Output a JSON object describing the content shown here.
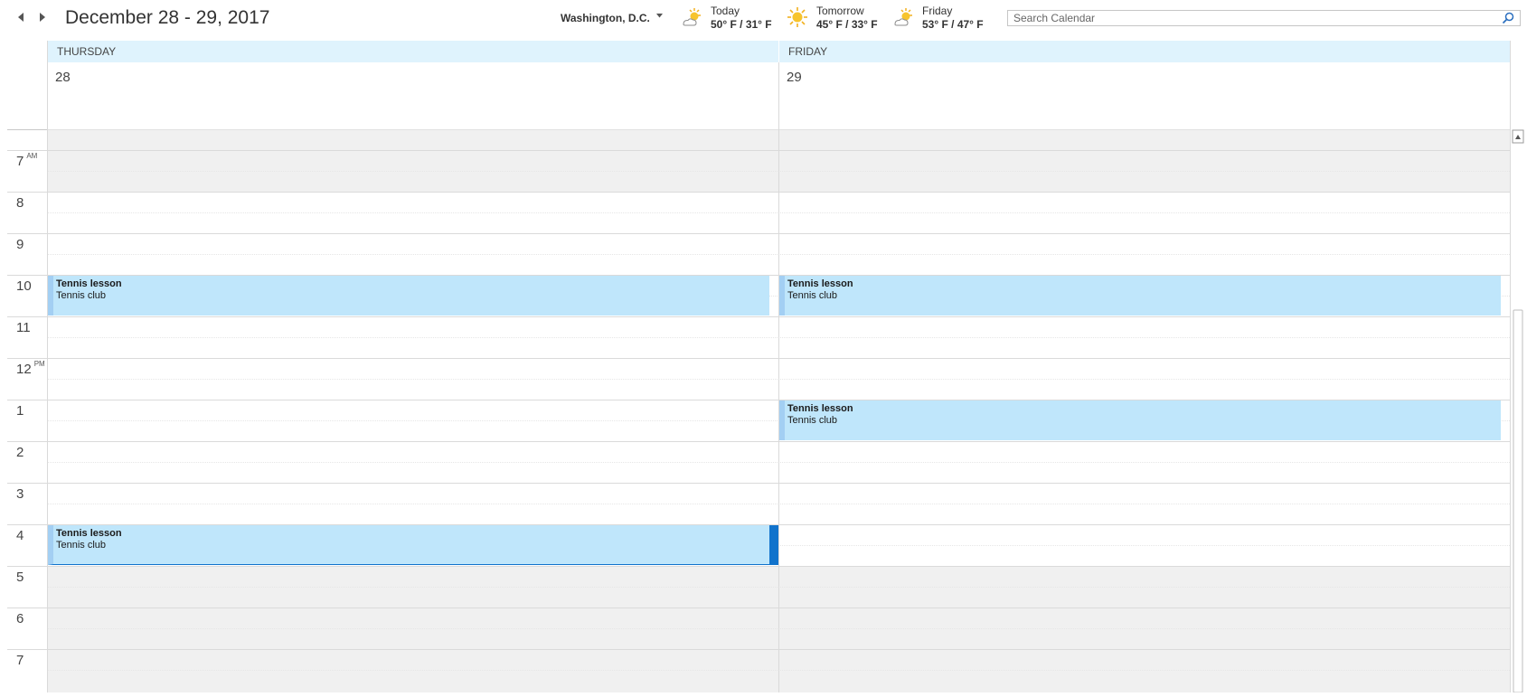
{
  "header": {
    "prev_label": "◀",
    "next_label": "▶",
    "title": "December 28 - 29, 2017",
    "location": "Washington,  D.C.",
    "location_caret": "▼"
  },
  "weather": [
    {
      "label": "Today",
      "temp": "50° F / 31° F",
      "icon": "partly-sunny-icon"
    },
    {
      "label": "Tomorrow",
      "temp": "45° F / 33° F",
      "icon": "sunny-icon"
    },
    {
      "label": "Friday",
      "temp": "53° F / 47° F",
      "icon": "partly-sunny-icon"
    }
  ],
  "search": {
    "placeholder": "Search Calendar"
  },
  "days": [
    {
      "name": "THURSDAY",
      "number": "28"
    },
    {
      "name": "FRIDAY",
      "number": "29"
    }
  ],
  "hours": [
    {
      "label": "7",
      "suffix": "AM"
    },
    {
      "label": "8",
      "suffix": ""
    },
    {
      "label": "9",
      "suffix": ""
    },
    {
      "label": "10",
      "suffix": ""
    },
    {
      "label": "11",
      "suffix": ""
    },
    {
      "label": "12",
      "suffix": "PM"
    },
    {
      "label": "1",
      "suffix": ""
    },
    {
      "label": "2",
      "suffix": ""
    },
    {
      "label": "3",
      "suffix": ""
    },
    {
      "label": "4",
      "suffix": ""
    },
    {
      "label": "5",
      "suffix": ""
    },
    {
      "label": "6",
      "suffix": ""
    },
    {
      "label": "7",
      "suffix": ""
    }
  ],
  "events": [
    {
      "title": "Tennis lesson",
      "location": "Tennis club"
    },
    {
      "title": "Tennis lesson",
      "location": "Tennis club"
    },
    {
      "title": "Tennis lesson",
      "location": "Tennis club"
    },
    {
      "title": "Tennis lesson",
      "location": "Tennis club"
    }
  ],
  "colors": {
    "header_bg": "#dff3fd",
    "event_bg": "#bfe6fb",
    "event_border": "#a3cff3",
    "selected_accent": "#1173cc",
    "off_hours_bg": "#f0f0f0"
  }
}
